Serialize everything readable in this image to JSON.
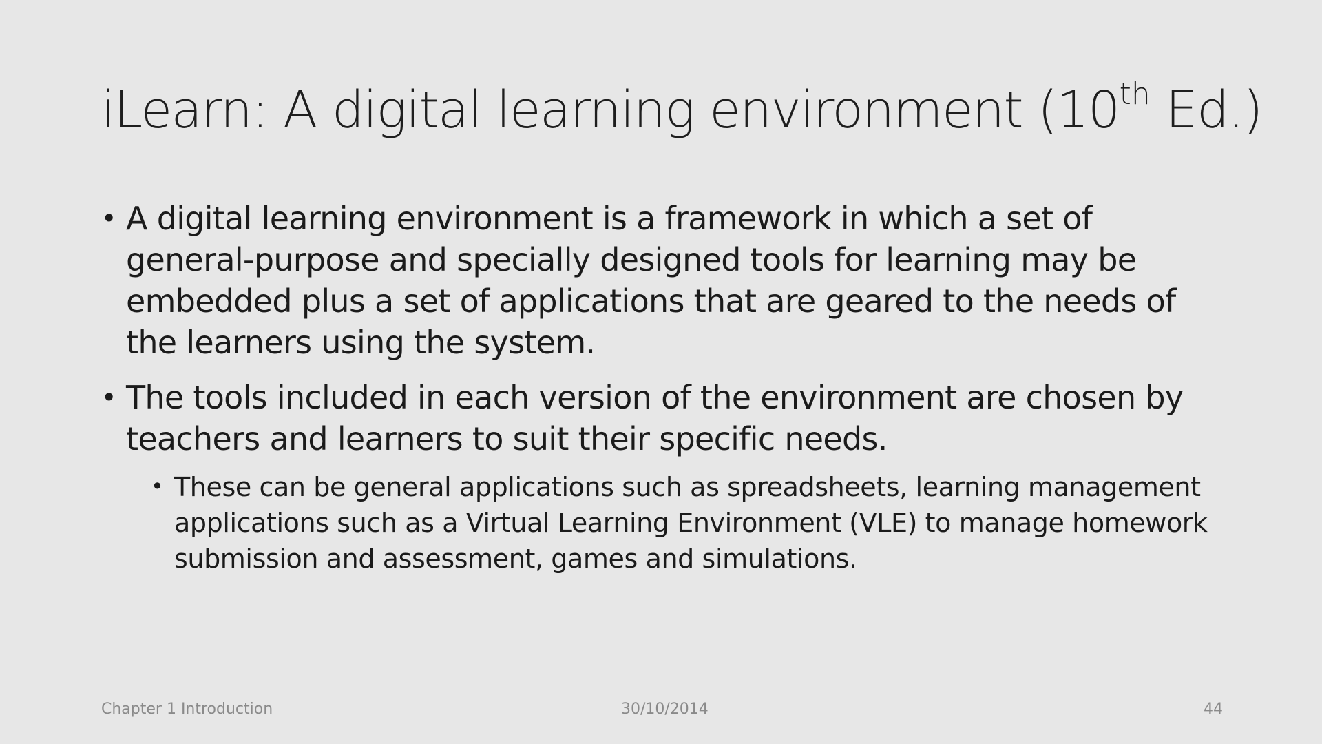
{
  "slide": {
    "title": {
      "main": "iLearn: A digital learning environment (10",
      "superscript": "th",
      "tail": " Ed.)"
    },
    "bullets": [
      {
        "text": "A digital learning environment is a framework in which a set of general-purpose and specially designed tools for learning may be embedded plus a set of applications that are geared to the needs of the learners using the system."
      },
      {
        "text": "The tools included in each version of the environment are chosen by teachers and learners to suit their specific needs.",
        "sub_bullets": [
          {
            "text": "These can be general applications such as spreadsheets, learning management applications such as a Virtual Learning Environment (VLE) to manage homework submission and assessment, games and simulations."
          }
        ]
      }
    ],
    "bullet_glyph": "•"
  },
  "footer": {
    "left": "Chapter 1 Introduction",
    "center": "30/10/2014",
    "right": "44"
  }
}
